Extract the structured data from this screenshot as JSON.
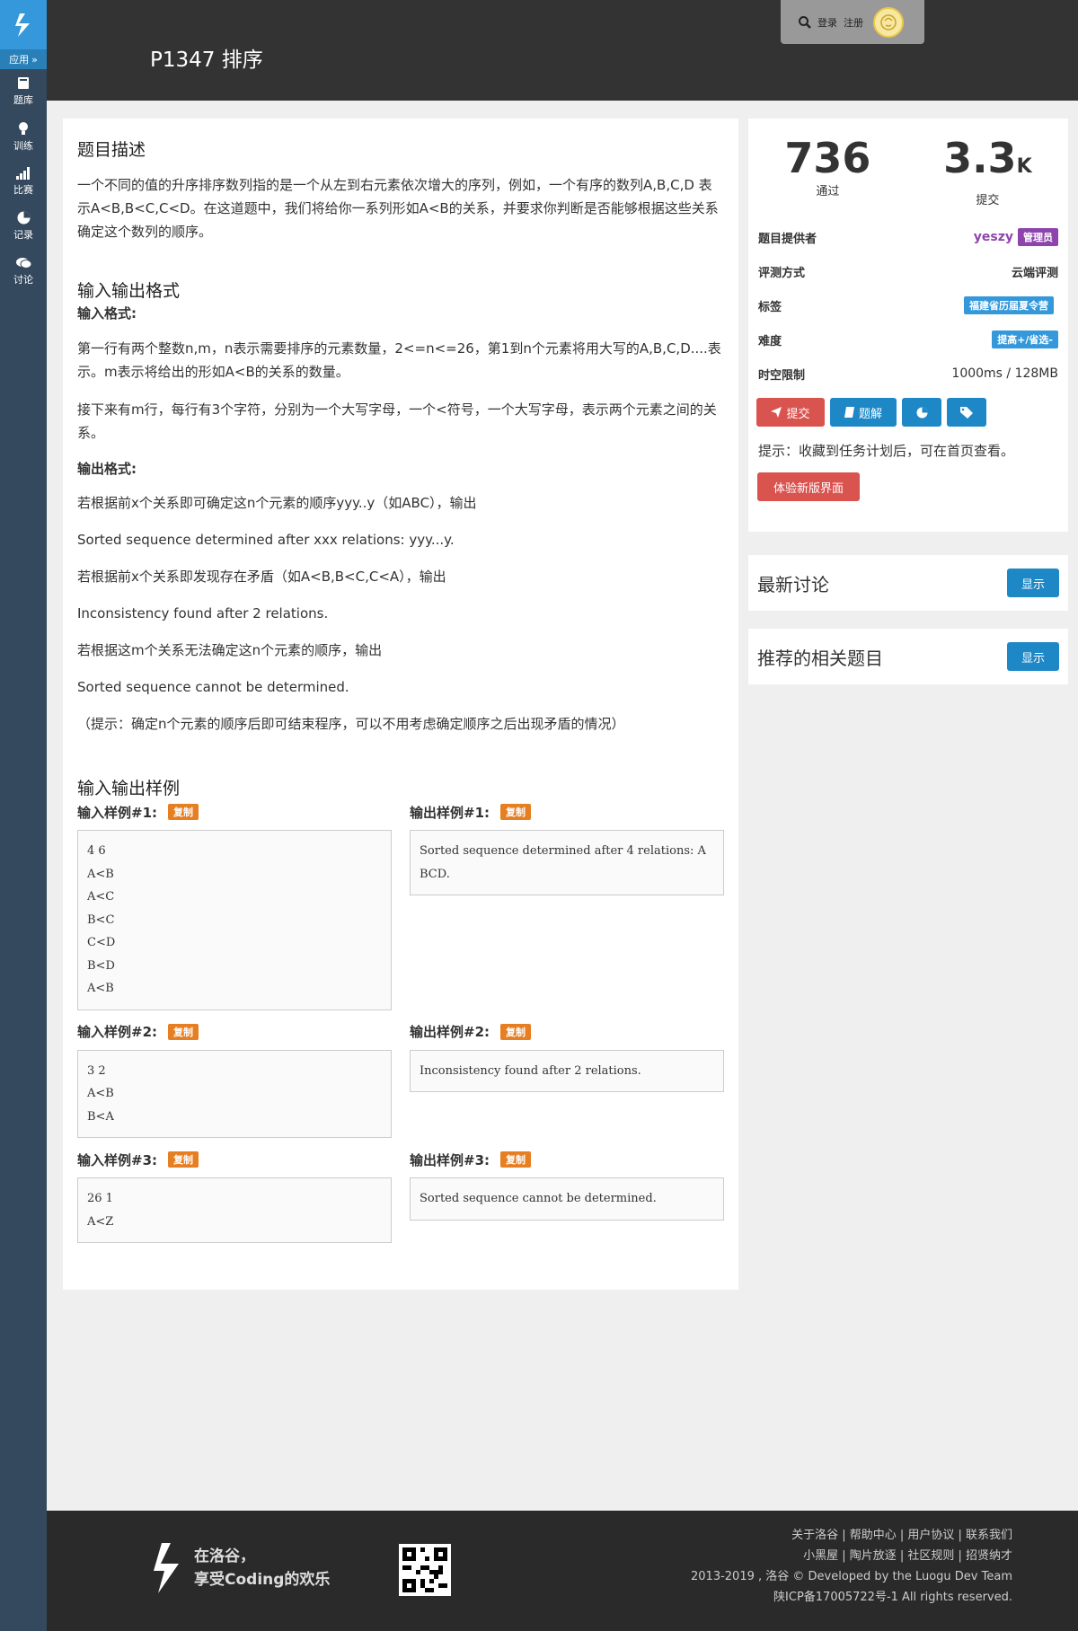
{
  "sidebar": {
    "app_label": "应用",
    "items": [
      {
        "label": "题库",
        "icon": "book-icon"
      },
      {
        "label": "训练",
        "icon": "lightbulb-icon"
      },
      {
        "label": "比赛",
        "icon": "signal-icon"
      },
      {
        "label": "记录",
        "icon": "pie-chart-icon"
      },
      {
        "label": "讨论",
        "icon": "comments-icon"
      }
    ]
  },
  "header": {
    "title": "P1347 排序",
    "login": "登录",
    "register": "注册"
  },
  "problem": {
    "desc_title": "题目描述",
    "desc_text": "一个不同的值的升序排序数列指的是一个从左到右元素依次增大的序列，例如，一个有序的数列A,B,C,D 表示A<B,B<C,C<D。在这道题中，我们将给你一系列形如A<B的关系，并要求你判断是否能够根据这些关系确定这个数列的顺序。",
    "io_title": "输入输出格式",
    "input_format_label": "输入格式:",
    "input_p1": "第一行有两个整数n,m，n表示需要排序的元素数量，2<=n<=26，第1到n个元素将用大写的A,B,C,D....表示。m表示将给出的形如A<B的关系的数量。",
    "input_p2": "接下来有m行，每行有3个字符，分别为一个大写字母，一个<符号，一个大写字母，表示两个元素之间的关系。",
    "output_format_label": "输出格式:",
    "output_lines": [
      "若根据前x个关系即可确定这n个元素的顺序yyy..y（如ABC），输出",
      "Sorted sequence determined after xxx relations: yyy...y.",
      "若根据前x个关系即发现存在矛盾（如A<B,B<C,C<A），输出",
      "Inconsistency found after 2 relations.",
      "若根据这m个关系无法确定这n个元素的顺序，输出",
      "Sorted sequence cannot be determined.",
      "（提示：确定n个元素的顺序后即可结束程序，可以不用考虑确定顺序之后出现矛盾的情况）"
    ],
    "samples_title": "输入输出样例",
    "copy_label": "复制",
    "samples": [
      {
        "in_label": "输入样例#1:",
        "out_label": "输出样例#1:",
        "input": "4 6\nA<B\nA<C\nB<C\nC<D\nB<D\nA<B",
        "output": "Sorted sequence determined after 4 relations: ABCD."
      },
      {
        "in_label": "输入样例#2:",
        "out_label": "输出样例#2:",
        "input": "3 2\nA<B\nB<A",
        "output": "Inconsistency found after 2 relations."
      },
      {
        "in_label": "输入样例#3:",
        "out_label": "输出样例#3:",
        "input": "26 1\nA<Z",
        "output": "Sorted sequence cannot be determined."
      }
    ]
  },
  "stats": {
    "passed": "736",
    "passed_label": "通过",
    "submitted": "3.3",
    "submitted_unit": "K",
    "submitted_label": "提交"
  },
  "info": {
    "provider_label": "题目提供者",
    "provider_name": "yeszy",
    "provider_role": "管理员",
    "judge_label": "评测方式",
    "judge_value": "云端评测",
    "tags_label": "标签",
    "tag_value": "福建省历届夏令营",
    "difficulty_label": "难度",
    "difficulty_value": "提高+/省选-",
    "limit_label": "时空限制",
    "limit_value": "1000ms / 128MB"
  },
  "actions": {
    "submit": "提交",
    "solution": "题解",
    "hint": "提示：收藏到任务计划后，可在首页查看。",
    "new_ui": "体验新版界面"
  },
  "cards": {
    "discussion_title": "最新讨论",
    "related_title": "推荐的相关题目",
    "show_label": "显示"
  },
  "colors": {
    "sidebar": "#34495e",
    "accent": "#3498db",
    "danger": "#d9534f",
    "primary": "#1e88c7",
    "admin": "#8e44ad",
    "copy": "#e67e22"
  },
  "footer": {
    "slogan_line1": "在洛谷，",
    "slogan_line2": "享受Coding的欢乐",
    "links_line1": "关于洛谷 | 帮助中心 | 用户协议 | 联系我们",
    "links_line2": "小黑屋 | 陶片放逐 | 社区规则 | 招贤纳才",
    "copyright": "2013-2019 , 洛谷 © Developed by the Luogu Dev Team",
    "icp": "陕ICP备17005722号-1 All rights reserved."
  }
}
